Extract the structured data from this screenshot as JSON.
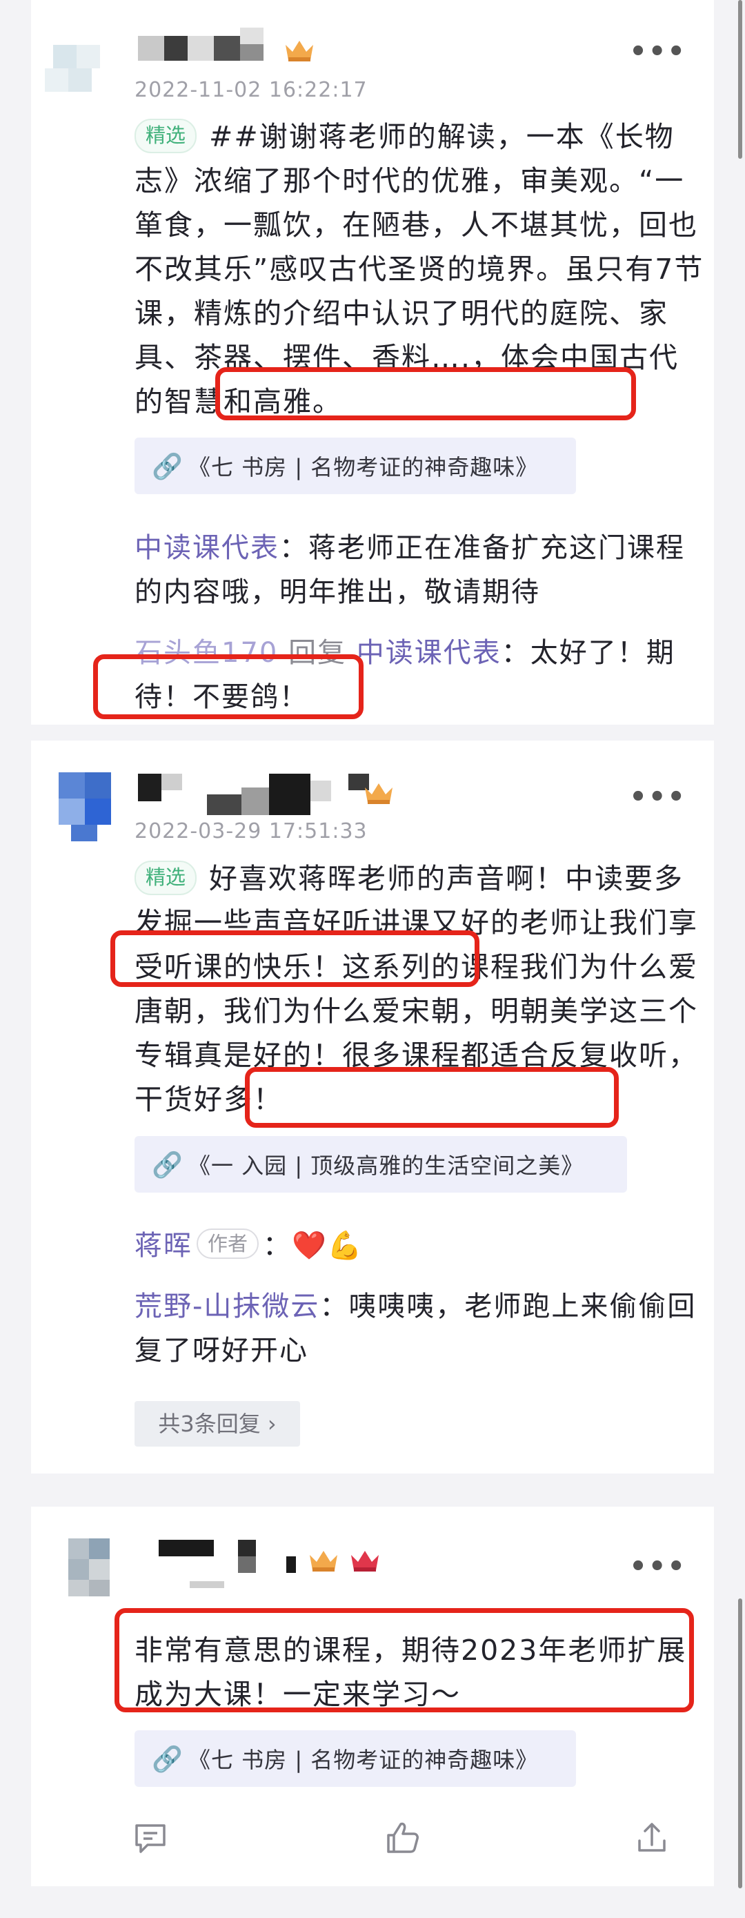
{
  "posts": [
    {
      "time": "2022-11-02 16:22:17",
      "tag": "精选",
      "text": "##谢谢蒋老师的解读，一本《长物志》浓缩了那个时代的优雅，审美观。“一箪食，一瓢饮，在陋巷，人不堪其忧，回也不改其乐”感叹古代圣贤的境界。虽只有7节课，精炼的介绍中认识了明代的庭院、家具、茶器、摆件、香料….，体会中国古代的智慧和高雅。",
      "link": "《七 书房 | 名物考证的神奇趣味》",
      "replies": [
        {
          "user": "中读课代表",
          "sep": "：",
          "text": "蒋老师正在准备扩充这门课程的内容哦，明年推出，敬请期待"
        },
        {
          "user": "石头鱼170",
          "mid": " 回复 ",
          "target": "中读课代表",
          "sep": "：",
          "text": "太好了！期待！不要鸽！"
        }
      ]
    },
    {
      "time": "2022-03-29 17:51:33",
      "tag": "精选",
      "text": "好喜欢蒋晖老师的声音啊！中读要多发掘一些声音好听讲课又好的老师让我们享受听课的快乐！这系列的课程我们为什么爱唐朝，我们为什么爱宋朝，明朝美学这三个专辑真是好的！很多课程都适合反复收听，干货好多！",
      "link": "《一 入园 | 顶级高雅的生活空间之美》",
      "replies": [
        {
          "user": "蒋晖",
          "author_tag": "作者",
          "sep": "：",
          "text": "❤️💪"
        },
        {
          "user": "荒野-山抹微云",
          "sep": "：",
          "text": "咦咦咦，老师跑上来偷偷回复了呀好开心"
        }
      ],
      "more_replies": "共3条回复 ›"
    },
    {
      "text": "非常有意思的课程，期待2023年老师扩展成为大课！一定来学习～",
      "link": "《七 书房 | 名物考证的神奇趣味》"
    }
  ],
  "more_icon": "•••",
  "icons": [
    "link-icon",
    "comment-icon",
    "like-icon",
    "share-icon",
    "crown-icon",
    "more-icon"
  ],
  "colors": {
    "accent": "#6c63b5",
    "highlight": "#e5241a",
    "tag_green": "#3fb07a",
    "link_bg": "#eeeffa"
  }
}
